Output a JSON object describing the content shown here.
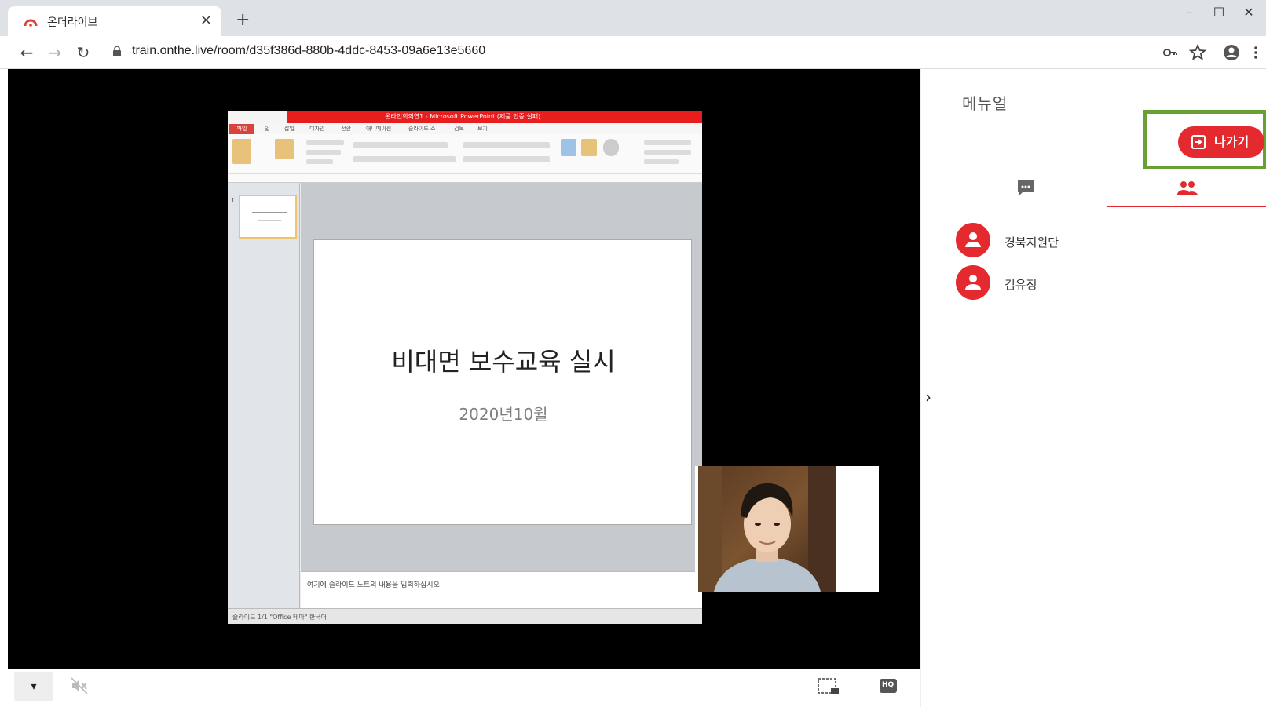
{
  "browser": {
    "tab_title": "온더라이브",
    "tab_close": "×",
    "new_tab": "+",
    "url": "train.onthe.live/room/d35f386d-880b-4ddc-8453-09a6e13e5660",
    "window_controls": {
      "minimize": "–",
      "maximize": "☐",
      "close": "✕"
    },
    "nav": {
      "back": "←",
      "forward": "→",
      "reload": "↻"
    },
    "brand_color": "#d9433b"
  },
  "presentation": {
    "app_title": "온라인회의연1 - Microsoft PowerPoint (제품 인증 실패)",
    "file_tab": "파일",
    "menu_tabs": [
      "홈",
      "삽입",
      "디자인",
      "전환",
      "애니메이션",
      "슬라이드 쇼",
      "검토",
      "보기"
    ],
    "slide_title": "비대면 보수교육 실시",
    "slide_subtitle": "2020년10월",
    "notes_placeholder": "여기에 슬라이드 노트의 내용을 입력하십시오",
    "status_text": "슬라이드 1/1   \"Office 테마\"   한국어",
    "slide_number": "1"
  },
  "controls": {
    "dropdown": "▾",
    "mute_icon": "speaker-muted-icon",
    "fullscreen_icon": "select-area-icon",
    "hq_label": "HQ"
  },
  "panel": {
    "title": "메뉴얼",
    "exit_label": "나가기",
    "collapse": "›",
    "tabs": [
      {
        "icon": "chat-icon",
        "active": false
      },
      {
        "icon": "people-icon",
        "active": true
      }
    ],
    "participants": [
      {
        "name": "경북지원단"
      },
      {
        "name": "김유정"
      }
    ],
    "accent_color": "#e42a2f",
    "highlight_color": "#6a9f33"
  }
}
